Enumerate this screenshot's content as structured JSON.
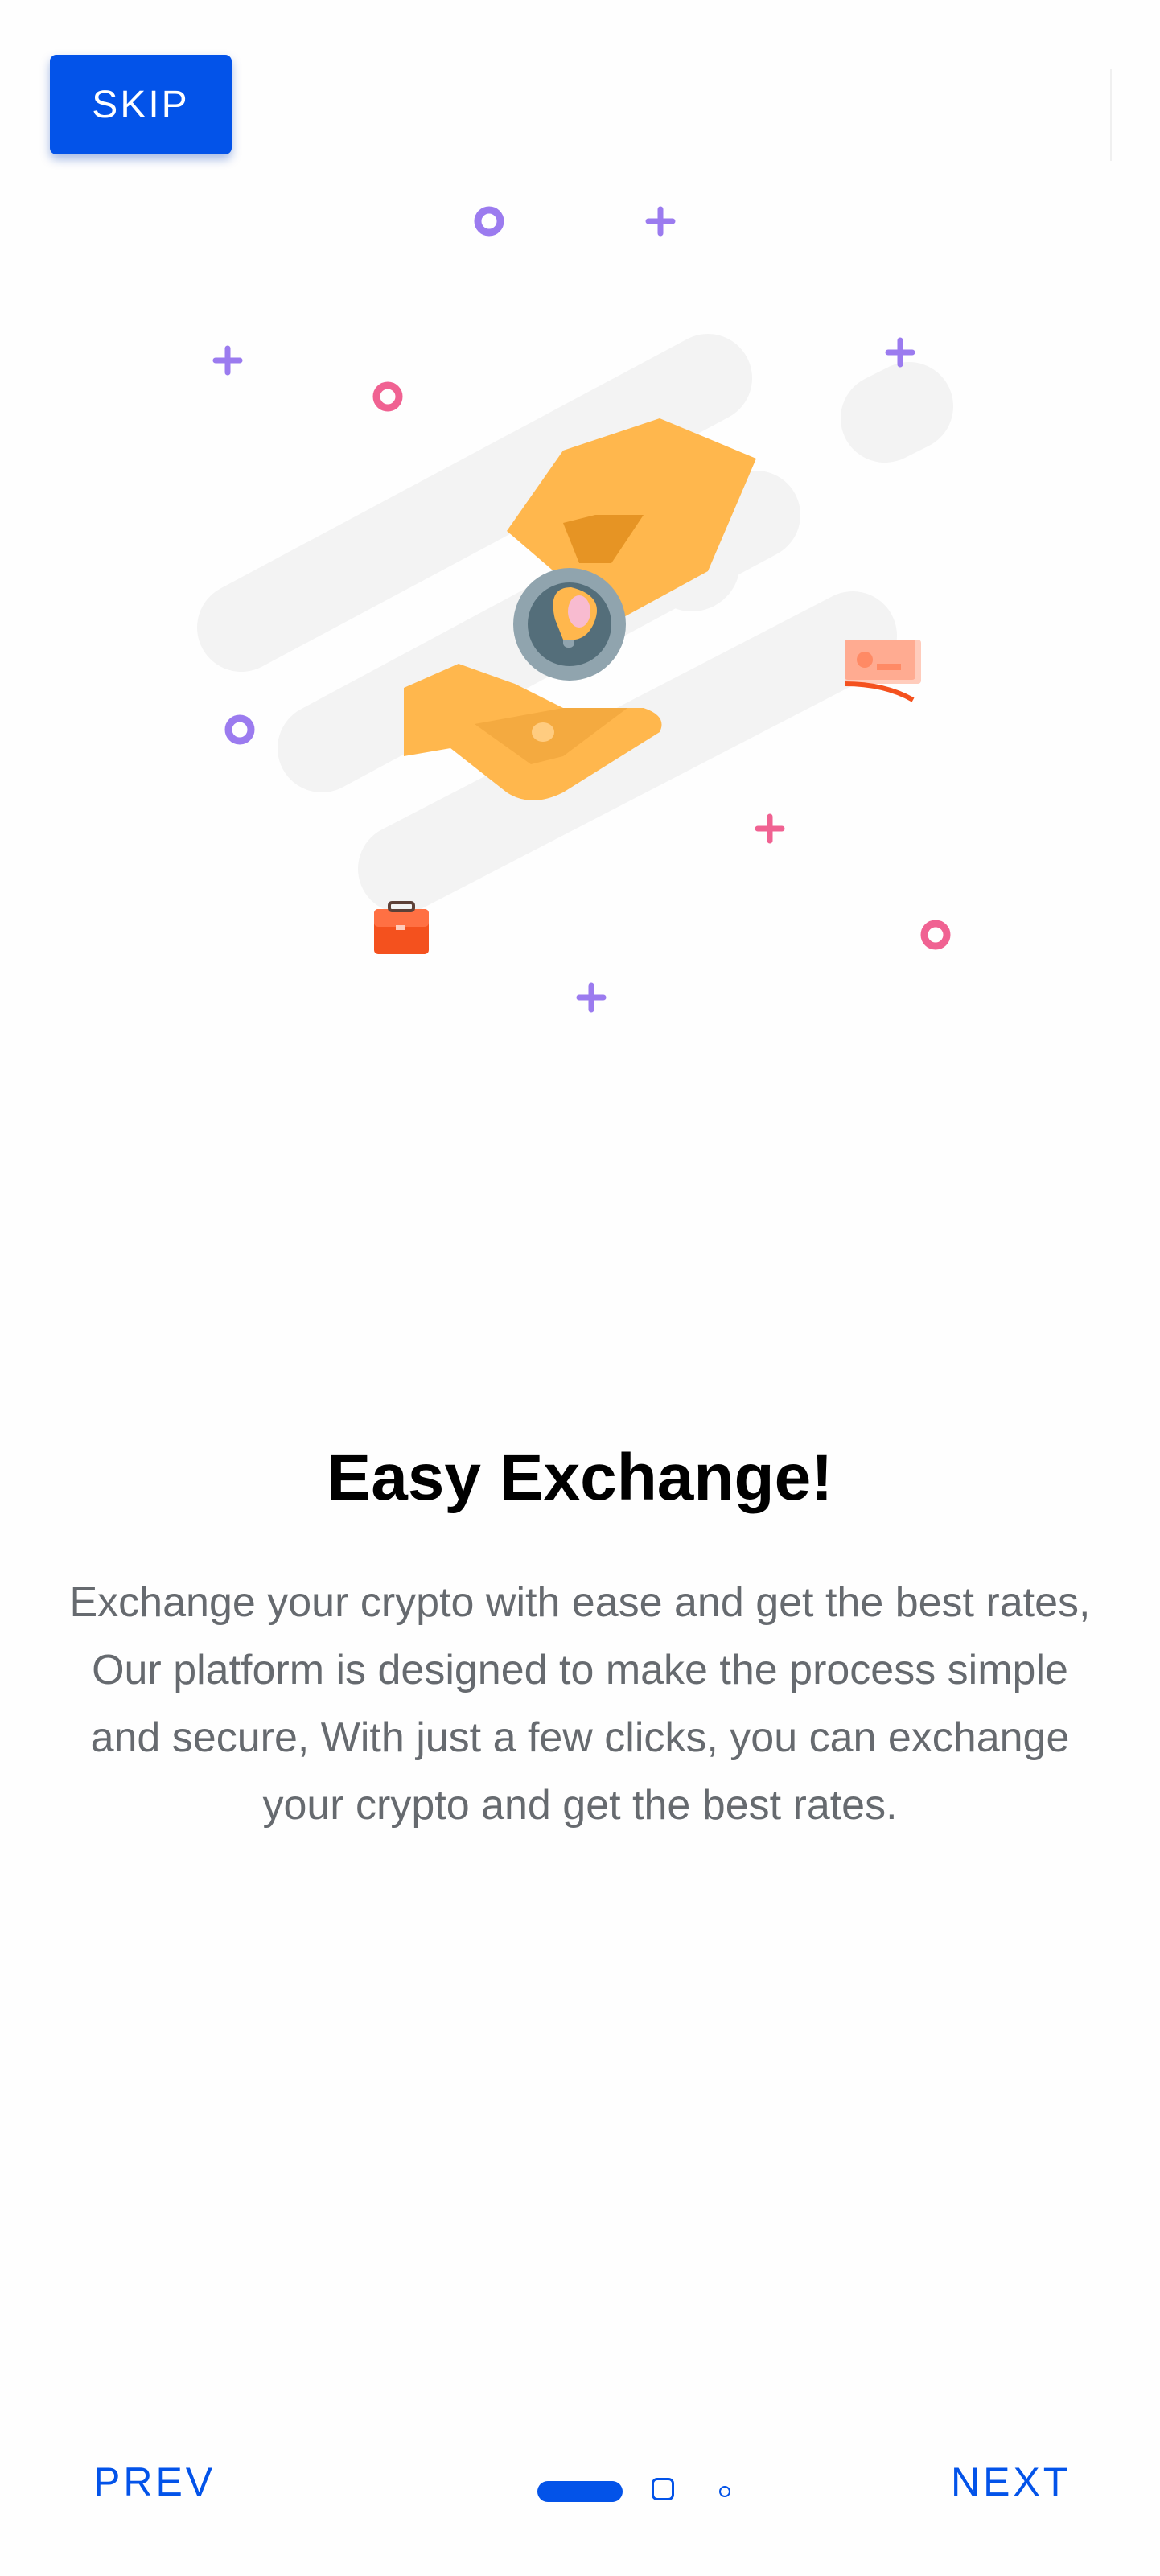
{
  "header": {
    "skip_label": "SKIP"
  },
  "slide": {
    "title": "Easy Exchange!",
    "description": "Exchange your crypto with ease and get the best rates, Our platform is designed to make the process simple and secure, With just a few clicks, you can exchange your crypto and get the best rates.",
    "illustration_icon": "hand-coin-exchange-illustration"
  },
  "footer": {
    "prev_label": "PREV",
    "next_label": "NEXT",
    "page_indicator": {
      "total": 3,
      "current": 1
    }
  },
  "colors": {
    "primary": "#0353e9",
    "text_primary": "#000000",
    "text_secondary": "#666a6f",
    "hand": "#ffb74d",
    "coin": "#546e7a",
    "accent_purple": "#9b7bef",
    "accent_pink": "#f06292",
    "accent_orange": "#f4511e"
  }
}
